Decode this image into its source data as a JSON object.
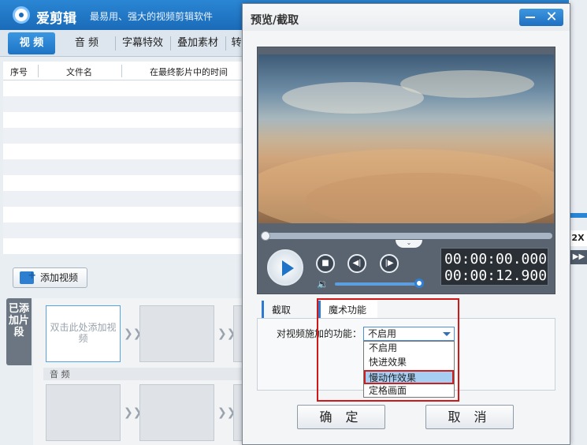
{
  "app": {
    "name": "爱剪辑",
    "slogan": "最易用、强大的视频剪辑软件",
    "tabs": [
      {
        "label": "视 频"
      },
      {
        "label": "音 频"
      },
      {
        "label": "字幕特效"
      },
      {
        "label": "叠加素材"
      },
      {
        "label": "转"
      }
    ],
    "table_headers": [
      "序号",
      "文件名",
      "在最终影片中的时间"
    ],
    "add_video_label": "添加视频",
    "side_tab_label": "已添加片段",
    "clip_placeholder": "双击此处添加视频",
    "audio_section_label": "音 频",
    "right_strip": {
      "speed_label": "2X",
      "ff_label": "▶▶"
    }
  },
  "dialog": {
    "title": "预览/截取",
    "current_time": "00:00:00.000",
    "total_time": "00:00:12.900",
    "seek_fraction": 0.0,
    "volume_fraction": 1.0,
    "tabs": [
      {
        "label": "截取"
      },
      {
        "label": "魔术功能"
      }
    ],
    "magic_label": "对视频施加的功能：",
    "combo_value": "不启用",
    "options": [
      "不启用",
      "快进效果",
      "慢动作效果",
      "定格画面"
    ],
    "highlighted_option": "慢动作效果",
    "ok_label": "确 定",
    "cancel_label": "取 消"
  },
  "colors": {
    "accent": "#1f74c7",
    "highlight_border": "#d01818"
  }
}
